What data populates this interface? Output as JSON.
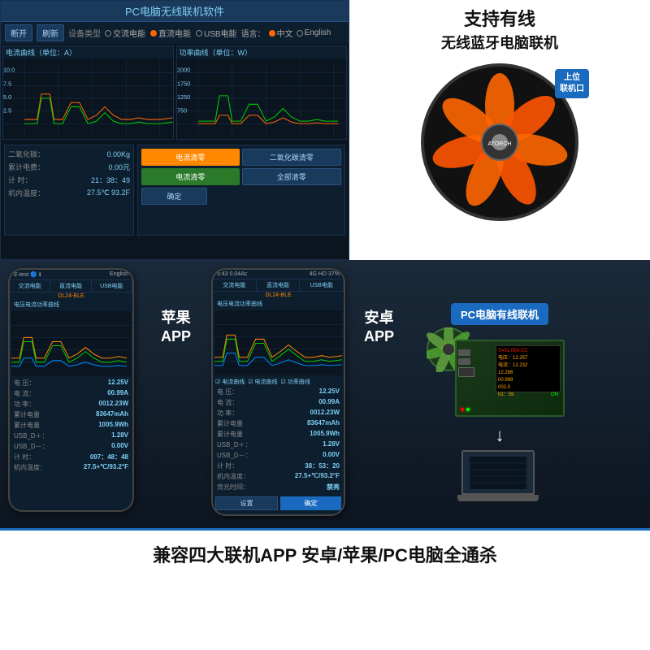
{
  "app": {
    "title": "PC电脑无线联机软件",
    "product_title_line1": "支持有线",
    "product_title_line2": "无线蓝牙电脑联机"
  },
  "toolbar": {
    "btn_open": "断开",
    "btn_refresh": "刷新",
    "device_type_label": "设备类型",
    "device_ac": "交流电能",
    "device_dc": "直流电能",
    "device_usb": "USB电能",
    "lang_label": "语言：",
    "lang_cn": "中文",
    "lang_en": "English"
  },
  "charts": {
    "current_title": "电流曲线（单位：A）",
    "power_title": "功率曲线（单位：W）",
    "current_y_max": "10.0",
    "current_y_mid": "5.0",
    "current_y_mid2": "2.5",
    "power_y_max": "2000",
    "power_y_mid": "1250",
    "power_y_mid2": "750"
  },
  "info": {
    "co2_label": "二氧化碳：",
    "co2_value": "0.00Kg",
    "total_cost_label": "累计电费：",
    "total_cost_value": "0.00元",
    "time_label": "计  时：",
    "time_value": "21：38：49",
    "temp_label": "机内温度：",
    "temp_value": "27.5℃ 93.2F",
    "btn_current_clear": "电流清零",
    "btn_co2_clear": "二氧化碳清零",
    "btn_current_set": "电流清零",
    "btn_global_clear": "全部清零",
    "btn_ok": "确定"
  },
  "apple_phone": {
    "label": "苹果\nAPP",
    "status_bar_left": "E-test  🔵  ℹ",
    "status_bar_right": "English",
    "tab1": "交流电能",
    "tab2": "直流电能",
    "tab3": "USB电能",
    "tab4": "DL24-BLE",
    "chart_title": "电压电流功率曲线",
    "voltage_label": "电  压：",
    "voltage_value": "12.25V",
    "current_label": "电  流：",
    "current_value": "00.99A",
    "power_label": "功  率：",
    "power_value": "0012.23W",
    "capacity_label": "累计电量",
    "capacity_value": "83647mAh",
    "energy_label": "累计电量",
    "energy_value": "1005.9Wh",
    "usb_d_plus": "USB_D＋：",
    "usb_d_plus_value": "1.28V",
    "usb_d_minus": "USB_D－：",
    "usb_d_minus_value": "0.00V",
    "timer_label": "计  时：",
    "timer_value": "097：48：48",
    "temp_label": "机内温度：",
    "temp_value": "27.5+℃/93.2°F"
  },
  "android_phone": {
    "label": "安卓\nAPP",
    "status_bar_left": "5:43  0.04Ac",
    "status_bar_right": "4G HD 37%",
    "tab1": "交流电能",
    "tab2": "直流电能",
    "tab3": "USB电能",
    "tab4": "DL24-BLE",
    "chart_title": "电压电流功率曲线",
    "voltage_label": "电  压：",
    "voltage_value": "12.25V",
    "current_label": "电  流：",
    "current_value": "00.99A",
    "power_label": "功  率：",
    "power_value": "0012.23W",
    "capacity_label": "累计电量",
    "capacity_value": "83647mAh",
    "energy_label": "累计电量",
    "energy_value": "1005.9Wh",
    "usb_d_plus": "USB_D＋：",
    "usb_d_plus_value": "1.28V",
    "usb_d_minus": "USB_D－：",
    "usb_d_minus_value": "0.00V",
    "timer_label": "计  时：",
    "timer_value": "38：53：20",
    "temp_label": "机内温度：",
    "temp_value": "27.5+℃/93.2°F",
    "backlight_label": "背光时间：",
    "backlight_value": "禁亮"
  },
  "circuit_display": {
    "line1": "S=01.00A  CC",
    "line2": "电压：12.257",
    "line3": "电流：12.232",
    "line4": "12.286",
    "line5": "00.999",
    "line6": "002.0",
    "line7": "01：59",
    "line8": "ON"
  },
  "labels": {
    "pc_wired": "PC电脑有线联机",
    "upper_computer": "上位\n联机口",
    "bottom_banner": "兼容四大联机APP 安卓/苹果/PC电脑全通杀"
  }
}
